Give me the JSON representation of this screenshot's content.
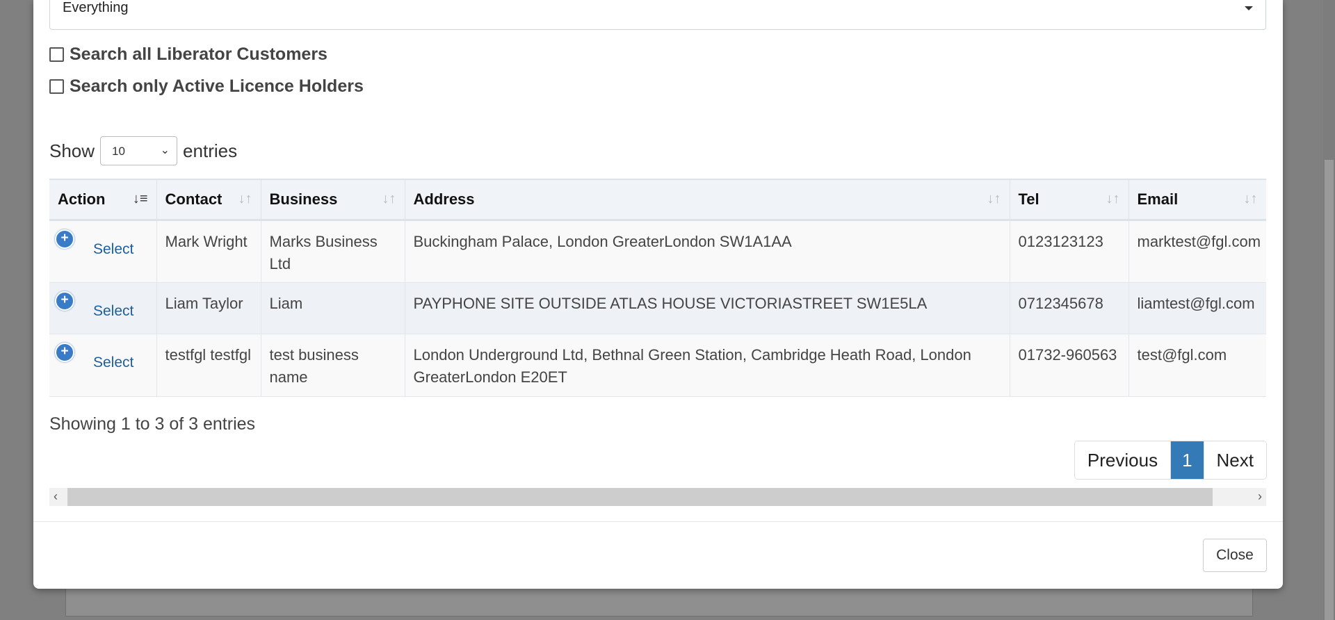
{
  "modal": {
    "search_scope": {
      "selected": "Everything"
    },
    "checkboxes": [
      {
        "label": "Search all Liberator Customers",
        "checked": false
      },
      {
        "label": "Search only Active Licence Holders",
        "checked": false
      }
    ],
    "length": {
      "prefix": "Show",
      "value": "10",
      "suffix": "entries"
    },
    "table": {
      "columns": [
        "Action",
        "Contact",
        "Business",
        "Address",
        "Tel",
        "Email"
      ],
      "rows": [
        {
          "action": "Select",
          "contact": "Mark Wright",
          "business": "Marks Business Ltd",
          "address": "Buckingham Palace, London GreaterLondon SW1A1AA",
          "tel": "0123123123",
          "email": "marktest@fgl.com"
        },
        {
          "action": "Select",
          "contact": "Liam Taylor",
          "business": "Liam",
          "address": "PAYPHONE SITE OUTSIDE ATLAS HOUSE VICTORIASTREET SW1E5LA",
          "tel": "0712345678",
          "email": "liamtest@fgl.com"
        },
        {
          "action": "Select",
          "contact": "testfgl testfgl",
          "business": "test business name",
          "address": "London Underground Ltd, Bethnal Green Station, Cambridge Heath Road, London GreaterLondon E20ET",
          "tel": "01732-960563",
          "email": "test@fgl.com"
        }
      ]
    },
    "info": "Showing 1 to 3 of 3 entries",
    "pagination": {
      "previous": "Previous",
      "current": "1",
      "next": "Next"
    },
    "close_label": "Close"
  },
  "colors": {
    "accent": "#337ab7",
    "link": "#1d5fa0",
    "overlay": "#808080"
  }
}
